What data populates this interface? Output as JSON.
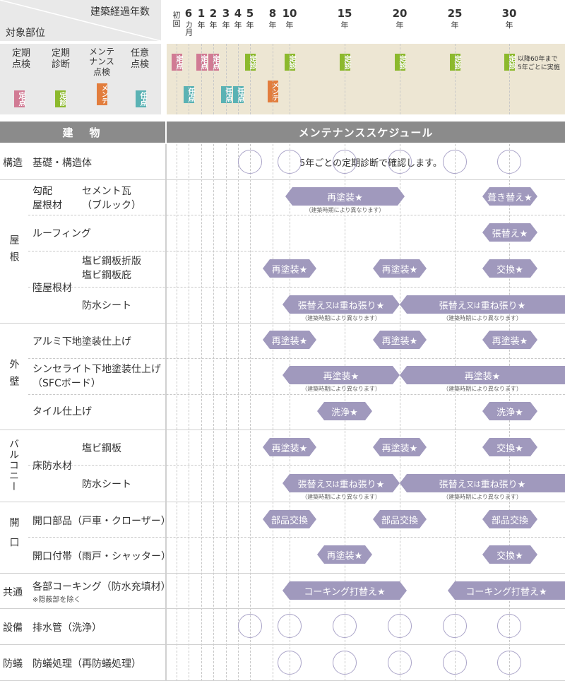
{
  "header": {
    "elapsed_label": "建築経過年数",
    "target_label": "対象部位",
    "years": [
      {
        "num": "初",
        "unit": "回"
      },
      {
        "num": "6",
        "unit": "カ月"
      },
      {
        "num": "1",
        "unit": "年"
      },
      {
        "num": "2",
        "unit": "年"
      },
      {
        "num": "3",
        "unit": "年"
      },
      {
        "num": "4",
        "unit": "年"
      },
      {
        "num": "5",
        "unit": "年"
      },
      {
        "num": "8",
        "unit": "年"
      },
      {
        "num": "10",
        "unit": "年"
      },
      {
        "num": "15",
        "unit": "年"
      },
      {
        "num": "20",
        "unit": "年"
      },
      {
        "num": "25",
        "unit": "年"
      },
      {
        "num": "30",
        "unit": "年"
      }
    ]
  },
  "legend": {
    "teiki_tenken": "定期\n点検",
    "teiki_shindan": "定期\n診断",
    "maintenance": "メンテ\nナンス\n点検",
    "nini_tenken": "任意\n点検",
    "tag_ten": "定点",
    "tag_shin": "定診",
    "tag_mente": "メンテ",
    "tag_nin": "任点",
    "after60_note": "以降60年まで\n5年ごとに実施"
  },
  "colors": {
    "ten": "#d17b94",
    "shin": "#8cb92d",
    "mente": "#e27d3d",
    "nin": "#5ab2b4",
    "pill": "#a099bd",
    "header_band": "#ede6d3"
  },
  "section_header": {
    "building": "建　物",
    "schedule": "メンテナンススケジュール"
  },
  "rows": {
    "structure": {
      "cat": "構造",
      "item": "基礎・構造体",
      "note": "5年ごとの定期診断で確認します。"
    },
    "roof": {
      "cat": "屋根",
      "slope": "勾配\n屋根材",
      "cement": "セメント瓦\n（ブルック）",
      "roofing": "ルーフィング",
      "flat": "陸屋根材",
      "pvc": "塩ビ鋼板折版\n塩ビ鋼板庇",
      "sheet": "防水シート"
    },
    "wall": {
      "cat": "外壁",
      "alumi": "アルミ下地塗装仕上げ",
      "syncera": "シンセライト下地塗装仕上げ\n（SFCボード）",
      "tile": "タイル仕上げ"
    },
    "balcony": {
      "cat": "バルコニー",
      "floor": "床防水材",
      "pvc": "塩ビ鋼板",
      "sheet": "防水シート"
    },
    "opening": {
      "cat": "開口",
      "parts": "開口部品（戸車・クローザー）",
      "attach": "開口付帯（雨戸・シャッター）"
    },
    "common": {
      "cat": "共通",
      "caulk": "各部コーキング（防水充填材）",
      "caulk_note": "※隠蔽部を除く"
    },
    "equip": {
      "cat": "設備",
      "drain": "排水管（洗浄）"
    },
    "termite": {
      "cat": "防蟻",
      "item": "防蟻処理（再防蟻処理）"
    }
  },
  "pills": {
    "repaint": "再塗装★",
    "reroof": "葺き替え★",
    "replace_cover": "張替え★",
    "exchange": "交換★",
    "reline_a": "張替え",
    "reline_or": "又は",
    "reline_b": "重ね張り★",
    "wash": "洗浄★",
    "parts": "部品交換",
    "caulk": "コーキング打替え★",
    "period_note": "（建築時期により異なります）"
  }
}
